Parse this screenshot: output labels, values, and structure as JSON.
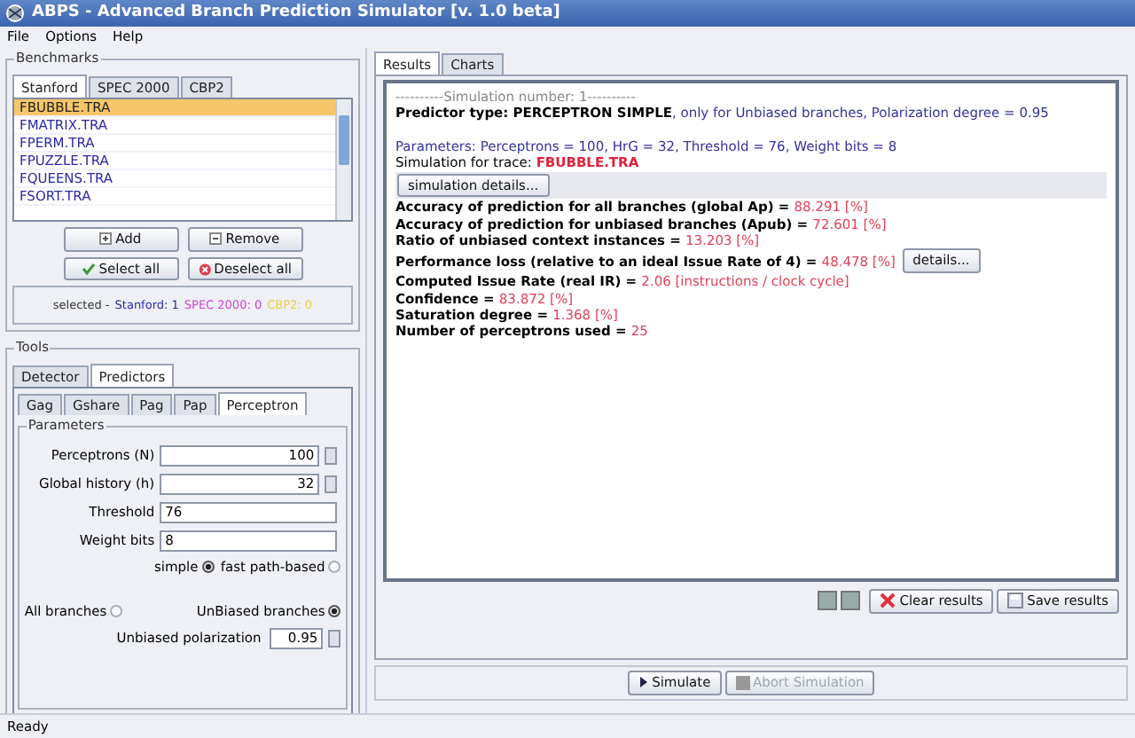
{
  "window": {
    "title": "ABPS - Advanced Branch Prediction Simulator [v. 1.0 beta]"
  },
  "menu": [
    "File",
    "Options",
    "Help"
  ],
  "benchmarks": {
    "title": "Benchmarks",
    "tabs": [
      {
        "label": "Stanford",
        "selected": true
      },
      {
        "label": "SPEC 2000",
        "selected": false
      },
      {
        "label": "CBP2",
        "selected": false
      }
    ],
    "files": [
      {
        "name": "FBUBBLE.TRA",
        "selected": true
      },
      {
        "name": "FMATRIX.TRA",
        "selected": false
      },
      {
        "name": "FPERM.TRA",
        "selected": false
      },
      {
        "name": "FPUZZLE.TRA",
        "selected": false
      },
      {
        "name": "FQUEENS.TRA",
        "selected": false
      },
      {
        "name": "FSORT.TRA",
        "selected": false
      }
    ],
    "buttons": [
      {
        "kind": "add",
        "label": "Add"
      },
      {
        "kind": "remove",
        "label": "Remove"
      },
      {
        "kind": "select",
        "label": "Select all"
      },
      {
        "kind": "deselect",
        "label": "Deselect all"
      }
    ],
    "summary": [
      {
        "text": "selected -",
        "color": "#333333"
      },
      {
        "text": "Stanford: 1",
        "color": "#2a2aa0"
      },
      {
        "text": "SPEC 2000: 0",
        "color": "#d040d0"
      },
      {
        "text": "CBP2: 0",
        "color": "#e8d040"
      }
    ]
  },
  "tools": {
    "title": "Tools",
    "tabs": [
      {
        "label": "Detector",
        "selected": false
      },
      {
        "label": "Predictors",
        "selected": true
      }
    ],
    "predictor_tabs": [
      {
        "label": "Gag",
        "selected": false
      },
      {
        "label": "Gshare",
        "selected": false
      },
      {
        "label": "Pag",
        "selected": false
      },
      {
        "label": "Pap",
        "selected": false
      },
      {
        "label": "Perceptron",
        "selected": true
      }
    ],
    "parameters": {
      "title": "Parameters",
      "fields": [
        {
          "kind": "spinner",
          "label": "Perceptrons (N)",
          "value": "100"
        },
        {
          "kind": "spinner",
          "label": "Global history (h)",
          "value": "32"
        },
        {
          "kind": "text",
          "label": "Threshold",
          "value": "76"
        },
        {
          "kind": "text",
          "label": "Weight bits",
          "value": "8"
        }
      ],
      "type_options": [
        {
          "label": "simple",
          "selected": true
        },
        {
          "label": "fast path-based",
          "selected": false
        }
      ],
      "branch_options": [
        {
          "label": "All branches",
          "selected": false
        },
        {
          "label": "UnBiased branches",
          "selected": true
        }
      ],
      "polarization": {
        "label": "Unbiased polarization",
        "value": "0.95"
      }
    }
  },
  "results_tabs": [
    {
      "label": "Results",
      "selected": true
    },
    {
      "label": "Charts",
      "selected": false
    }
  ],
  "results": [
    {
      "kind": "line",
      "parts": [
        {
          "kind": "separator",
          "text": "----------Simulation number: 1----------"
        }
      ]
    },
    {
      "kind": "line",
      "parts": [
        {
          "kind": "label",
          "text": "Predictor type: PERCEPTRON SIMPLE"
        },
        {
          "kind": "info",
          "text": ", only for Unbiased branches, Polarization degree = 0.95"
        }
      ]
    },
    {
      "kind": "gap"
    },
    {
      "kind": "line",
      "parts": [
        {
          "kind": "info",
          "text": "Parameters: Perceptrons = 100, HrG = 32, Threshold = 76, Weight bits = 8"
        }
      ]
    },
    {
      "kind": "line",
      "parts": [
        {
          "kind": "plain",
          "text": "Simulation for trace: "
        },
        {
          "kind": "trace",
          "text": "FBUBBLE.TRA"
        }
      ]
    },
    {
      "kind": "button",
      "label": "simulation details..."
    },
    {
      "kind": "line",
      "parts": [
        {
          "kind": "label",
          "text": "Accuracy of prediction for all branches (global Ap) = "
        },
        {
          "kind": "value",
          "text": "88.291 [%]"
        }
      ]
    },
    {
      "kind": "line",
      "parts": [
        {
          "kind": "label",
          "text": "Accuracy of prediction for unbiased branches (Apub) = "
        },
        {
          "kind": "value",
          "text": "72.601 [%]"
        }
      ]
    },
    {
      "kind": "line",
      "parts": [
        {
          "kind": "label",
          "text": "Ratio of unbiased context instances = "
        },
        {
          "kind": "value",
          "text": "13.203 [%]"
        }
      ]
    },
    {
      "kind": "line",
      "parts": [
        {
          "kind": "label",
          "text": "Performance loss (relative to an ideal Issue Rate of 4) = "
        },
        {
          "kind": "value",
          "text": "48.478 [%]"
        }
      ],
      "button": "details..."
    },
    {
      "kind": "line",
      "parts": [
        {
          "kind": "label",
          "text": "Computed Issue Rate (real IR) = "
        },
        {
          "kind": "value",
          "text": "2.06 [instructions / clock cycle]"
        }
      ]
    },
    {
      "kind": "line",
      "parts": [
        {
          "kind": "label",
          "text": "Confidence = "
        },
        {
          "kind": "value",
          "text": "83.872 [%]"
        }
      ]
    },
    {
      "kind": "line",
      "parts": [
        {
          "kind": "label",
          "text": "Saturation degree = "
        },
        {
          "kind": "value",
          "text": "1.368 [%]"
        }
      ]
    },
    {
      "kind": "line",
      "parts": [
        {
          "kind": "label",
          "text": "Number of perceptrons used = "
        },
        {
          "kind": "value",
          "text": "25"
        }
      ]
    }
  ],
  "result_actions": [
    {
      "kind": "clear",
      "label": "Clear results"
    },
    {
      "kind": "save",
      "label": "Save results"
    }
  ],
  "simulation_buttons": [
    {
      "kind": "play",
      "label": "Simulate",
      "disabled": false
    },
    {
      "kind": "stop",
      "label": "Abort Simulation",
      "disabled": true
    }
  ],
  "status_bar": "Ready"
}
